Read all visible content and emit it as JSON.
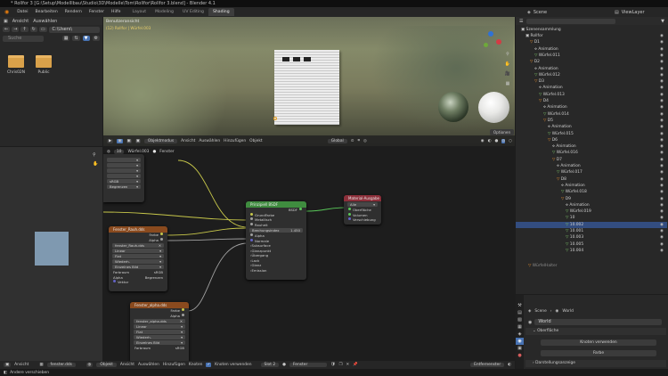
{
  "window": {
    "title": "* Rollfor 3 [G:\\Setup\\Modelllbau\\Studio\\3D\\Modelle\\Tom\\Rollfor\\Rollfor 3.blend] - Blender 4.1"
  },
  "menu": {
    "items": [
      "Datei",
      "Bearbeiten",
      "Rendern",
      "Fenster",
      "Hilfe"
    ]
  },
  "workspaces": {
    "tabs": [
      "Layout",
      "Modeling",
      "UV Editing",
      "Shading"
    ],
    "active": "Shading"
  },
  "topright": {
    "scene": "Scene",
    "view_layer": "ViewLayer"
  },
  "filebrowser": {
    "header": [
      "Ansicht",
      "Auswählen"
    ],
    "path": "C:\\Users\\",
    "search_placeholder": "Suche",
    "items": [
      {
        "name": "Chris02N"
      },
      {
        "name": "Public"
      }
    ]
  },
  "viewport": {
    "mode_label": "Benutzeransicht",
    "info_line": "(12) Rollfor | Würfel.003",
    "header_left": [
      "Objektmodus",
      "Ansicht",
      "Auswählen",
      "Hinzufügen",
      "Objekt"
    ],
    "transform": "Global",
    "options": "Optionen"
  },
  "node_editor": {
    "header": [
      "Ansicht",
      "Auswählen",
      "Hinzufügen",
      "Knoten"
    ],
    "use_nodes_label": "Knoten verwenden",
    "object_label": "Objekt",
    "slot": "Slot 2",
    "material_name": "Fenster",
    "top_strip": {
      "count": "10",
      "object": "Würfel.003",
      "material": "Fenster"
    },
    "bottom_left": {
      "view": "Ansicht",
      "file": "fenster.dds"
    },
    "bottom_right": {
      "inset": "Entfernenster"
    }
  },
  "nodes": {
    "partial_left": {
      "rows": [
        "sRGB",
        "Begrenzen"
      ]
    },
    "img1": {
      "title": "Fenster_Rauh.dds",
      "outputs": [
        "Farbe",
        "Alpha"
      ],
      "file": "fenster_Rauh.dds",
      "rows": [
        "Linear",
        "Flat",
        "Wiederh.",
        "Einzelnes Bild"
      ],
      "colorspace_label": "Farbraum",
      "colorspace": "sRGB",
      "alpha_label": "Alpha",
      "alpha": "Begrenzen",
      "vector": "Vektor"
    },
    "bsdf": {
      "title": "Prinzipiell BSDF",
      "output": "BSDF",
      "rows": [
        "GrundFarbe",
        "Metallisch",
        "Rauheit",
        "Brechungsindex",
        "Alpha",
        "Normale"
      ],
      "ior_value": "1.450",
      "subsections": [
        "Subsurface",
        "Glanzpunkt",
        "Übergang",
        "Lack",
        "Glanz",
        "Emission"
      ]
    },
    "output": {
      "title": "Material-Ausgabe",
      "target": "Alle",
      "inputs": [
        "Oberfläche",
        "Volumen",
        "Verschiebung"
      ]
    },
    "img2": {
      "title": "Fenster_alpha.dds",
      "outputs": [
        "Farbe",
        "Alpha"
      ],
      "file": "fenster_alpha.dds",
      "rows": [
        "Linear",
        "Flat",
        "Wiederh.",
        "Einzelnes Bild"
      ],
      "colorspace_label": "Farbraum",
      "colorspace": "sRGB",
      "alpha_label": "Alpha",
      "alpha": "Begrenzen",
      "vector": "Vektor"
    }
  },
  "outliner": {
    "root": "Szenensammlung",
    "rows": [
      {
        "label": "Rollfor",
        "indent": 1,
        "type": "coll"
      },
      {
        "label": "D1",
        "indent": 2,
        "type": "obj"
      },
      {
        "label": "Animation",
        "indent": 3,
        "type": "anim"
      },
      {
        "label": "Würfel.011",
        "indent": 3,
        "type": "mesh"
      },
      {
        "label": "D2",
        "indent": 2,
        "type": "obj"
      },
      {
        "label": "Animation",
        "indent": 3,
        "type": "anim"
      },
      {
        "label": "Würfel.012",
        "indent": 3,
        "type": "mesh"
      },
      {
        "label": "D3",
        "indent": 3,
        "type": "obj"
      },
      {
        "label": "Animation",
        "indent": 4,
        "type": "anim"
      },
      {
        "label": "Würfel.013",
        "indent": 4,
        "type": "mesh"
      },
      {
        "label": "D4",
        "indent": 4,
        "type": "obj"
      },
      {
        "label": "Animation",
        "indent": 5,
        "type": "anim"
      },
      {
        "label": "Würfel.014",
        "indent": 5,
        "type": "mesh"
      },
      {
        "label": "D5",
        "indent": 5,
        "type": "obj"
      },
      {
        "label": "Animation",
        "indent": 6,
        "type": "anim"
      },
      {
        "label": "Würfel.015",
        "indent": 6,
        "type": "mesh"
      },
      {
        "label": "D6",
        "indent": 6,
        "type": "obj"
      },
      {
        "label": "Animation",
        "indent": 7,
        "type": "anim"
      },
      {
        "label": "Würfel.016",
        "indent": 7,
        "type": "mesh"
      },
      {
        "label": "D7",
        "indent": 7,
        "type": "obj"
      },
      {
        "label": "Animation",
        "indent": 8,
        "type": "anim"
      },
      {
        "label": "Würfel.017",
        "indent": 8,
        "type": "mesh"
      },
      {
        "label": "D8",
        "indent": 8,
        "type": "obj"
      },
      {
        "label": "Animation",
        "indent": 9,
        "type": "anim"
      },
      {
        "label": "Würfel.018",
        "indent": 9,
        "type": "mesh"
      },
      {
        "label": "D9",
        "indent": 9,
        "type": "obj"
      },
      {
        "label": "Animation",
        "indent": 10,
        "type": "anim"
      },
      {
        "label": "Würfel.019",
        "indent": 10,
        "type": "mesh"
      },
      {
        "label": "10",
        "indent": 10,
        "type": "mesh"
      },
      {
        "label": "10.002",
        "indent": 10,
        "type": "mesh",
        "selected": true
      },
      {
        "label": "10.001",
        "indent": 10,
        "type": "mesh"
      },
      {
        "label": "10.003",
        "indent": 10,
        "type": "mesh"
      },
      {
        "label": "10.005",
        "indent": 10,
        "type": "mesh"
      },
      {
        "label": "10.004",
        "indent": 10,
        "type": "mesh"
      }
    ],
    "footer": "WürfelHalter"
  },
  "properties": {
    "scene": "Scene",
    "world_tab": "World",
    "world_name": "World",
    "surface_panel": "Oberfläche",
    "use_nodes_btn": "Knoten verwenden",
    "color_label": "Farbe",
    "volume_panel": "Darstellungsanzeige"
  },
  "status": {
    "left": "Andere verschieben"
  },
  "colors": {
    "accent": "#4772b3",
    "selected_row": "#334d80",
    "node_shader": "#3f8c3f",
    "node_output": "#8c2f3a",
    "node_texture": "#b45a1e"
  }
}
